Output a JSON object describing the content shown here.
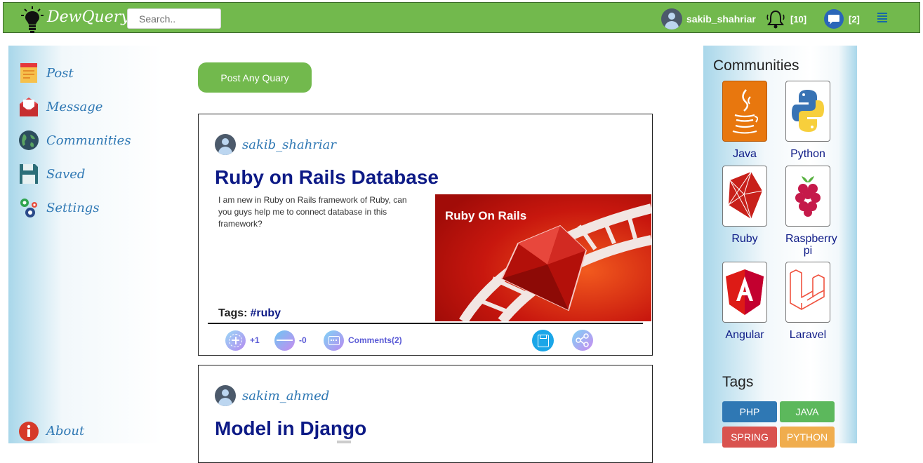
{
  "header": {
    "brand": "DewQuery",
    "search_placeholder": "Search..",
    "username": "sakib_shahriar",
    "notifications_count": "[10]",
    "messages_count": "[2]",
    "colors": {
      "bar": "#72b94d",
      "link_blue": "#1668a8"
    }
  },
  "left_sidebar": {
    "items": [
      {
        "label": "Post",
        "icon": "post-note-icon"
      },
      {
        "label": "Message",
        "icon": "envelope-icon"
      },
      {
        "label": "Communities",
        "icon": "globe-icon"
      },
      {
        "label": "Saved",
        "icon": "floppy-disk-icon"
      },
      {
        "label": "Settings",
        "icon": "gears-icon"
      }
    ],
    "about": {
      "label": "About",
      "icon": "info-icon"
    }
  },
  "main": {
    "post_button": "Post Any Quary",
    "posts": [
      {
        "author": "sakib_shahriar",
        "title": "Ruby on Rails Database",
        "body": "I am new in Ruby on Rails framework of Ruby, can you guys help me to connect database in this framework?",
        "image_caption": "Ruby On Rails",
        "tags_label": "Tags:",
        "tag": "#ruby",
        "upvotes": "+1",
        "downvotes": "-0",
        "comments": "Comments(2)"
      },
      {
        "author": "sakim_ahmed",
        "title": "Model in Django"
      }
    ]
  },
  "right_sidebar": {
    "communities_heading": "Communities",
    "communities": [
      {
        "label": "Java",
        "icon": "java-icon"
      },
      {
        "label": "Python",
        "icon": "python-icon"
      },
      {
        "label": "Ruby",
        "icon": "ruby-icon"
      },
      {
        "label": "Raspberry pi",
        "icon": "raspberry-pi-icon"
      },
      {
        "label": "Angular",
        "icon": "angular-icon"
      },
      {
        "label": "Laravel",
        "icon": "laravel-icon"
      }
    ],
    "tags_heading": "Tags",
    "tags": [
      {
        "label": "PHP",
        "color": "#2f78b4"
      },
      {
        "label": "JAVA",
        "color": "#5cb85c"
      },
      {
        "label": "SPRING",
        "color": "#d9534f"
      },
      {
        "label": "PYTHON",
        "color": "#f0ad4e"
      }
    ]
  }
}
